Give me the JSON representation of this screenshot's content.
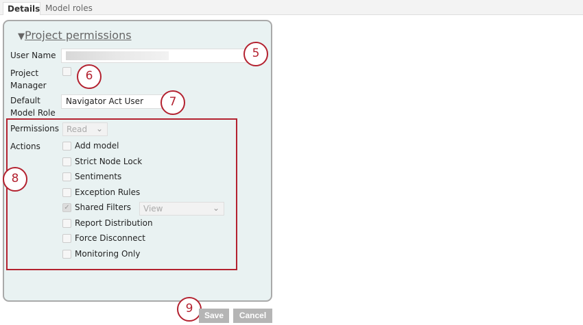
{
  "tabs": [
    {
      "label": "Details",
      "active": true
    },
    {
      "label": "Model roles",
      "active": false
    }
  ],
  "section": {
    "title": "Project permissions",
    "toggle_icon": "triangle-down-icon"
  },
  "form": {
    "user_name_label": "User Name",
    "project_manager_label_1": "Project",
    "project_manager_label_2": "Manager",
    "project_manager_checked": false,
    "default_role_label_1": "Default",
    "default_role_label_2": "Model Role",
    "default_role_value": "Navigator Act User",
    "permissions_label": "Permissions",
    "permissions_value": "Read",
    "actions_label": "Actions",
    "actions": [
      {
        "label": "Add model",
        "checked": false
      },
      {
        "label": "Strict Node Lock",
        "checked": false
      },
      {
        "label": "Sentiments",
        "checked": false
      },
      {
        "label": "Exception Rules",
        "checked": false
      },
      {
        "label": "Shared Filters",
        "checked": true
      },
      {
        "label": "Report Distribution",
        "checked": false
      },
      {
        "label": "Force Disconnect",
        "checked": false
      },
      {
        "label": "Monitoring Only",
        "checked": false
      }
    ],
    "shared_filters_value": "View"
  },
  "buttons": {
    "save": "Save",
    "cancel": "Cancel"
  },
  "callouts": [
    "5",
    "6",
    "7",
    "8",
    "9"
  ],
  "colors": {
    "callout": "#b3212f",
    "panel": "#e9f2f2"
  }
}
